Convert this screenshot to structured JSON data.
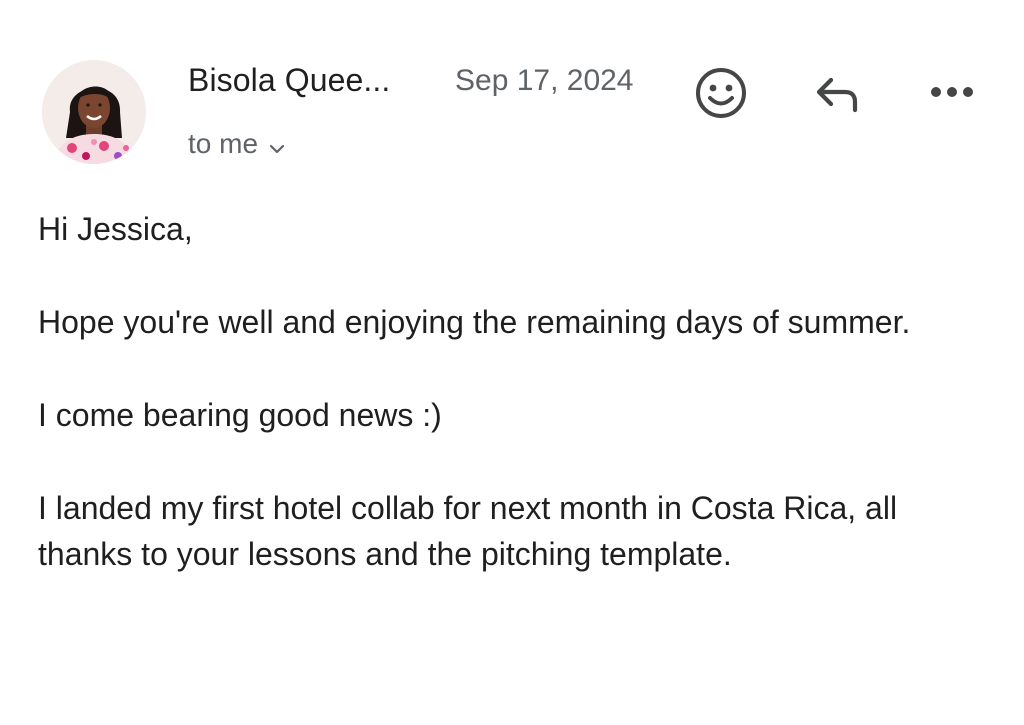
{
  "email": {
    "sender_name": "Bisola Quee...",
    "date": "Sep 17, 2024",
    "recipient_label": "to me",
    "icons": {
      "emoji": "smiley-face-icon",
      "reply": "reply-arrow-icon",
      "more": "more-options-icon",
      "expand": "chevron-down-icon"
    },
    "body": {
      "greeting": "Hi Jessica,",
      "paragraph_1": "Hope you're well and enjoying the remaining days of summer.",
      "paragraph_2": "I come bearing good news :)",
      "paragraph_3": "I landed my first hotel collab for next month in Costa Rica, all thanks to your lessons and the pitching template."
    }
  },
  "colors": {
    "text": "#1f1f1f",
    "secondary_text": "#5f6368",
    "icon": "#444746",
    "background": "#ffffff"
  }
}
